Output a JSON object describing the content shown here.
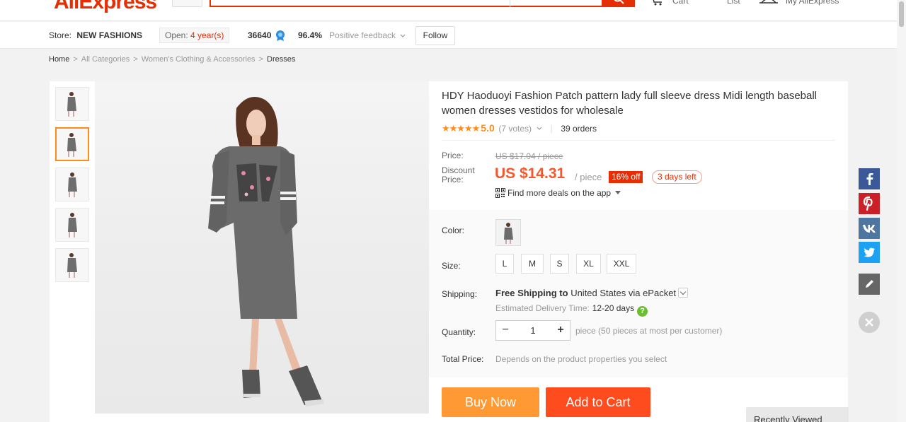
{
  "header": {
    "logo_text": "AliExpress",
    "links": {
      "cart": "Cart",
      "wish_list": "List",
      "account": "My AliExpress"
    }
  },
  "store": {
    "label": "Store:",
    "name": "NEW FASHIONS",
    "open_label": "Open:",
    "open_years": "4 year(s)",
    "score": "36640",
    "feedback_pct": "96.4%",
    "feedback_label": "Positive feedback",
    "follow_label": "Follow"
  },
  "breadcrumb": [
    "Home",
    "All Categories",
    "Women's Clothing & Accessories",
    "Dresses"
  ],
  "product": {
    "title": "HDY Haoduoyi Fashion Patch pattern lady full sleeve dress Midi length baseball women dresses vestidos for wholesale",
    "stars": "★★★★★",
    "rating": "5.0",
    "votes": "(7 votes)",
    "orders": "39 orders",
    "price_label": "Price:",
    "original_price": "US $17.04 / piece",
    "discount_label": "Discount Price:",
    "discount_price": "US $14.31",
    "per_piece": "/ piece",
    "off_badge": "16% off",
    "days_left": "3 days left",
    "app_deal": "Find more deals on the app"
  },
  "sku": {
    "color_label": "Color:",
    "size_label": "Size:",
    "sizes": [
      "L",
      "M",
      "S",
      "XL",
      "XXL"
    ],
    "shipping_label": "Shipping:",
    "shipping_free": "Free Shipping to",
    "shipping_dest": "United States via ePacket",
    "delivery_label": "Estimated Delivery Time:",
    "delivery_days": "12-20 days",
    "quantity_label": "Quantity:",
    "quantity_value": "1",
    "quantity_note": "piece (50 pieces at most per customer)",
    "total_label": "Total Price:",
    "total_note": "Depends on the product properties you select"
  },
  "actions": {
    "buy_now": "Buy Now",
    "add_to_cart": "Add to Cart"
  },
  "recently_viewed": "Recently Viewed",
  "colors": {
    "brand": "#e62e04",
    "price": "#f5582c",
    "buy_now": "#ff9933",
    "add_to_cart": "#ff4c1f",
    "star": "#ff8c1a",
    "facebook": "#3b5998",
    "pinterest": "#cb2027",
    "vk": "#4d76a1",
    "twitter": "#1da1f2"
  },
  "icons": [
    "search-icon",
    "cart-icon",
    "heart-icon",
    "user-icon",
    "medal-icon",
    "qr-icon",
    "help-icon",
    "facebook-icon",
    "pinterest-icon",
    "vk-icon",
    "twitter-icon",
    "edit-icon",
    "close-icon"
  ]
}
